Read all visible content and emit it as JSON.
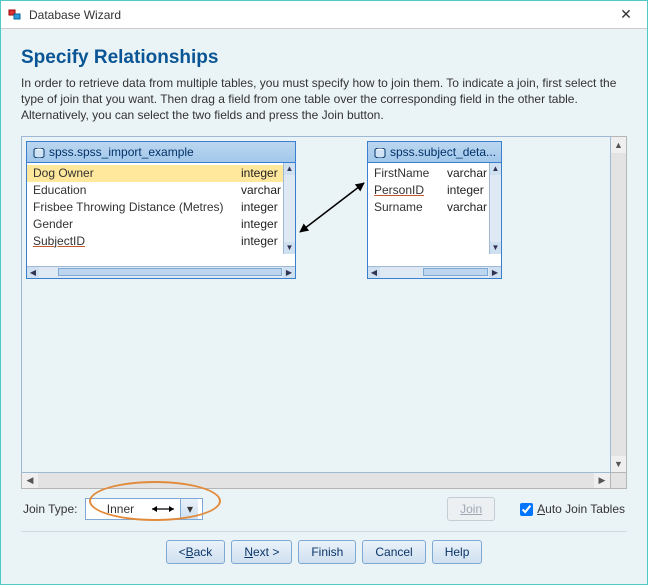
{
  "window": {
    "title": "Database Wizard"
  },
  "page": {
    "heading": "Specify Relationships",
    "description": "In order to retrieve data from multiple tables, you must specify how to join them. To indicate a join, first select the type of join that you want. Then drag a field from one table over the corresponding field in the other table. Alternatively, you can select the two fields and press the Join button."
  },
  "tables": {
    "left": {
      "name": "spss.spss_import_example",
      "fields": [
        {
          "name": "Dog Owner",
          "type": "integer",
          "selected": true,
          "linked": false
        },
        {
          "name": "Education",
          "type": "varchar",
          "selected": false,
          "linked": false
        },
        {
          "name": "Frisbee Throwing Distance (Metres)",
          "type": "integer",
          "selected": false,
          "linked": false
        },
        {
          "name": "Gender",
          "type": "integer",
          "selected": false,
          "linked": false
        },
        {
          "name": "SubjectID",
          "type": "integer",
          "selected": false,
          "linked": true
        }
      ]
    },
    "right": {
      "name": "spss.subject_deta...",
      "fields": [
        {
          "name": "FirstName",
          "type": "varchar",
          "selected": false,
          "linked": false
        },
        {
          "name": "PersonID",
          "type": "integer",
          "selected": false,
          "linked": true
        },
        {
          "name": "Surname",
          "type": "varchar",
          "selected": false,
          "linked": false
        }
      ]
    }
  },
  "join": {
    "label": "Join Type:",
    "selected": "Inner",
    "button": "Join",
    "auto_label_pre": "A",
    "auto_label_post": "uto Join Tables",
    "auto_checked": true
  },
  "nav": {
    "back_pre": "< ",
    "back_u": "B",
    "back_post": "ack",
    "next_u": "N",
    "next_post": "ext >",
    "finish": "Finish",
    "cancel": "Cancel",
    "help": "Help"
  }
}
